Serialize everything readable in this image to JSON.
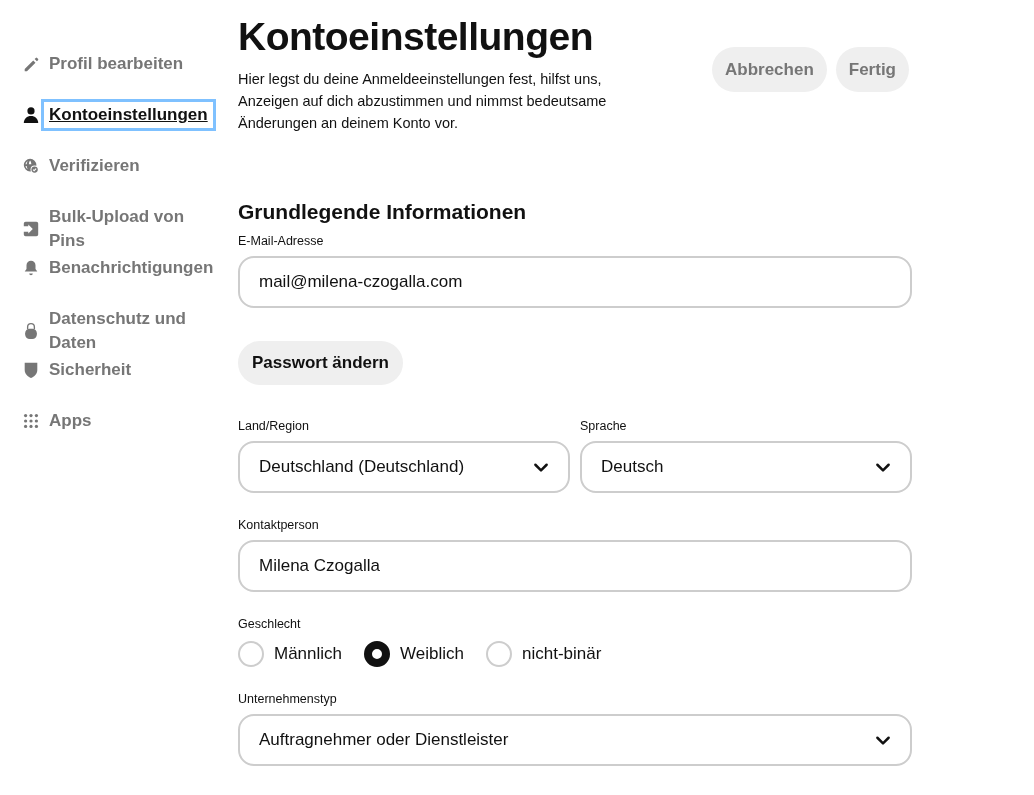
{
  "sidebar": {
    "items": [
      {
        "label": "Profil bearbeiten",
        "kind": "pencil",
        "selected": false
      },
      {
        "label": "Kontoeinstellungen",
        "kind": "person",
        "selected": true
      },
      {
        "label": "Verifizieren",
        "kind": "globe",
        "selected": false
      },
      {
        "label": "Bulk-Upload von Pins",
        "kind": "upload",
        "selected": false
      },
      {
        "label": "Benachrichtigungen",
        "kind": "bell",
        "selected": false
      },
      {
        "label": "Datenschutz und Daten",
        "kind": "lock",
        "selected": false
      },
      {
        "label": "Sicherheit",
        "kind": "shield",
        "selected": false
      },
      {
        "label": "Apps",
        "kind": "grid",
        "selected": false
      }
    ]
  },
  "header": {
    "title": "Kontoeinstellungen",
    "description": "Hier legst du deine Anmeldeeinstellungen fest, hilfst uns, Anzeigen auf dich abzustimmen und nimmst bedeutsame Änderungen an deinem Konto vor.",
    "buttons": [
      "Abbrechen",
      "Fertig"
    ]
  },
  "section": {
    "heading": "Grundlegende Informationen",
    "email": {
      "label": "E-Mail-Adresse",
      "value": "mail@milena-czogalla.com"
    },
    "password_button": "Passwort ändern",
    "country": {
      "label": "Land/Region",
      "value": "Deutschland (Deutschland)"
    },
    "language": {
      "label": "Sprache",
      "value": "Deutsch"
    },
    "contact": {
      "label": "Kontaktperson",
      "value": "Milena Czogalla"
    },
    "gender": {
      "label": "Geschlecht",
      "options": [
        {
          "label": "Männlich",
          "selected": false
        },
        {
          "label": "Weiblich",
          "selected": true
        },
        {
          "label": "nicht-binär",
          "selected": false
        }
      ]
    },
    "business_type": {
      "label": "Unternehmenstyp",
      "value": "Auftragnehmer oder Dienstleister"
    }
  }
}
